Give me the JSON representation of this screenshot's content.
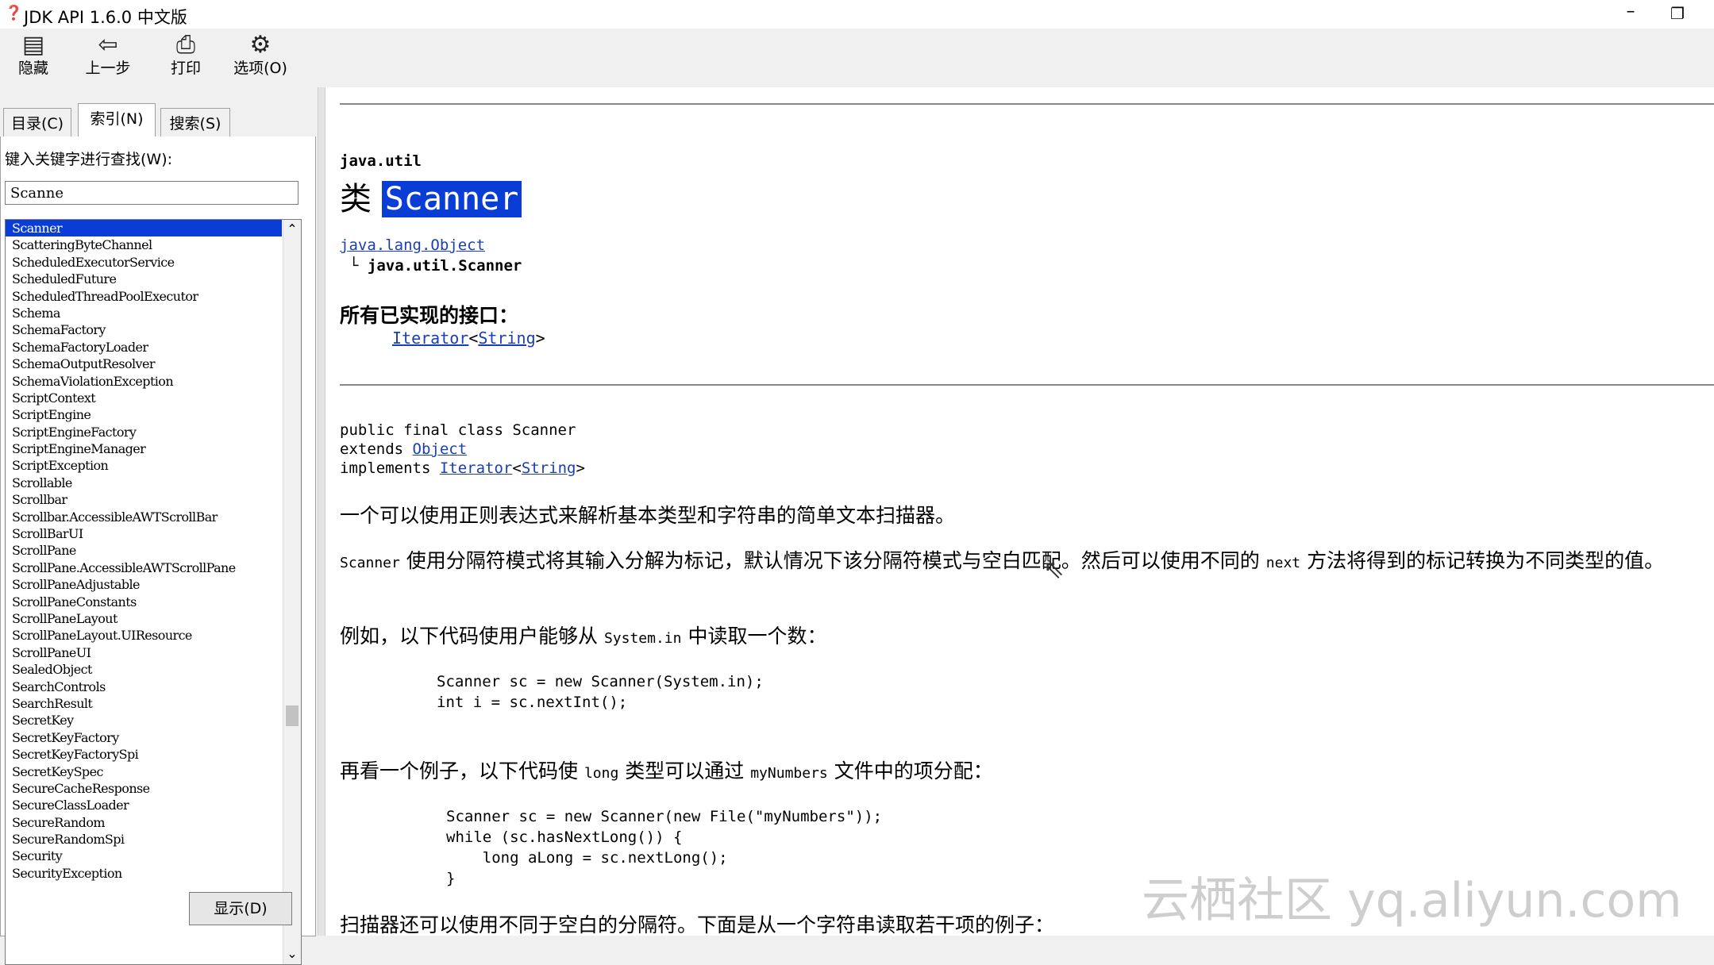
{
  "window": {
    "title": "JDK API 1.6.0 中文版",
    "minimize": "–",
    "maximize": "❐"
  },
  "toolbar": {
    "hide": "隐藏",
    "back": "上一步",
    "print": "打印",
    "options": "选项(O)"
  },
  "nav": {
    "tabs": [
      "目录(C)",
      "索引(N)",
      "搜索(S)"
    ],
    "keyword_label": "键入关键字进行查找(W):",
    "keyword_value": "Scanne",
    "show_button": "显示(D)",
    "items": [
      "Scanner",
      "ScatteringByteChannel",
      "ScheduledExecutorService",
      "ScheduledFuture",
      "ScheduledThreadPoolExecutor",
      "Schema",
      "SchemaFactory",
      "SchemaFactoryLoader",
      "SchemaOutputResolver",
      "SchemaViolationException",
      "ScriptContext",
      "ScriptEngine",
      "ScriptEngineFactory",
      "ScriptEngineManager",
      "ScriptException",
      "Scrollable",
      "Scrollbar",
      "Scrollbar.AccessibleAWTScrollBar",
      "ScrollBarUI",
      "ScrollPane",
      "ScrollPane.AccessibleAWTScrollPane",
      "ScrollPaneAdjustable",
      "ScrollPaneConstants",
      "ScrollPaneLayout",
      "ScrollPaneLayout.UIResource",
      "ScrollPaneUI",
      "SealedObject",
      "SearchControls",
      "SearchResult",
      "SecretKey",
      "SecretKeyFactory",
      "SecretKeyFactorySpi",
      "SecretKeySpec",
      "SecureCacheResponse",
      "SecureClassLoader",
      "SecureRandom",
      "SecureRandomSpi",
      "Security",
      "SecurityException"
    ]
  },
  "doc": {
    "package": "java.util",
    "class_prefix": "类",
    "class_name": "Scanner",
    "parent_link": "java.lang.Object",
    "child": "└ java.util.Scanner",
    "impl_heading": "所有已实现的接口：",
    "impl_iface": "Iterator",
    "impl_type": "String",
    "decl_line1": "public final class Scanner",
    "decl_extends": "extends",
    "decl_object": "Object",
    "decl_implements": "implements",
    "decl_iterator": "Iterator",
    "decl_string": "String",
    "para1": "一个可以使用正则表达式来解析基本类型和字符串的简单文本扫描器。",
    "para2_code": "Scanner",
    "para2_a": " 使用分隔符模式将其输入分解为标记，默认情况下该分隔符模式与空白匹配。然后可以使用不同的 ",
    "para2_next": "next",
    "para2_b": " 方法将得到的标记转换为不同类型的值。",
    "para3_a": "例如，以下代码使用户能够从 ",
    "para3_code": "System.in",
    "para3_b": " 中读取一个数：",
    "code1_l1": "Scanner sc = new Scanner(System.in);",
    "code1_l2": "int i = sc.nextInt();",
    "para4_a": "再看一个例子，以下代码使 ",
    "para4_long": "long",
    "para4_b": " 类型可以通过 ",
    "para4_file": "myNumbers",
    "para4_c": " 文件中的项分配：",
    "code2_l1": "Scanner sc = new Scanner(new File(\"myNumbers\"));",
    "code2_l2": "while (sc.hasNextLong()) {",
    "code2_l3": "    long aLong = sc.nextLong();",
    "code2_l4": "}",
    "para5": "扫描器还可以使用不同于空白的分隔符。下面是从一个字符串读取若干项的例子："
  },
  "watermark": "云栖社区 yq.aliyun.com"
}
